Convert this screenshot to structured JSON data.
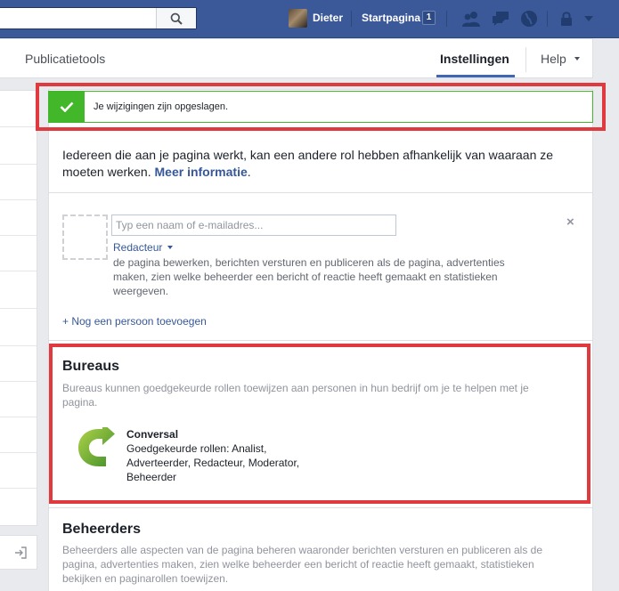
{
  "topbar": {
    "search_placeholder": "",
    "user_name": "Dieter",
    "home_label": "Startpagina",
    "home_count": "1",
    "icons": [
      "friends-icon",
      "messages-icon",
      "globe-icon",
      "lock-icon",
      "chevron-down-icon"
    ]
  },
  "subnav": {
    "publishing_tools": "Publicatietools",
    "settings": "Instellingen",
    "help": "Help"
  },
  "notice": {
    "text": "Je wijzigingen zijn opgeslagen.",
    "color": "#42b72a"
  },
  "intro": {
    "text": "Iedereen die aan je pagina werkt, kan een andere rol hebben afhankelijk van waaraan ze moeten werken. ",
    "link": "Meer informatie",
    "after_link": "."
  },
  "add_role": {
    "placeholder": "Typ een naam of e-mailadres...",
    "role": "Redacteur",
    "role_description": "de pagina bewerken, berichten versturen en publiceren als de pagina, advertenties maken, zien welke beheerder een bericht of reactie heeft gemaakt en statistieken weergeven.",
    "remove": "×",
    "add_person": "+ Nog een persoon toevoegen"
  },
  "agencies": {
    "title": "Bureaus",
    "description": "Bureaus kunnen goedgekeurde rollen toewijzen aan personen in hun bedrijf om je te helpen met je pagina.",
    "agency_name": "Conversal",
    "agency_roles": "Goedgekeurde rollen: Analist, Adverteerder, Redacteur, Moderator, Beheerder"
  },
  "admins": {
    "title": "Beheerders",
    "description": "Beheerders alle aspecten van de pagina beheren waaronder berichten versturen en publiceren als de pagina, advertenties maken, zien welke beheerder een bericht of reactie heeft gemaakt, statistieken bekijken en paginarollen toewijzen."
  },
  "colors": {
    "topbar": "#3b5998",
    "link": "#365899",
    "highlight": "#e0393e"
  }
}
